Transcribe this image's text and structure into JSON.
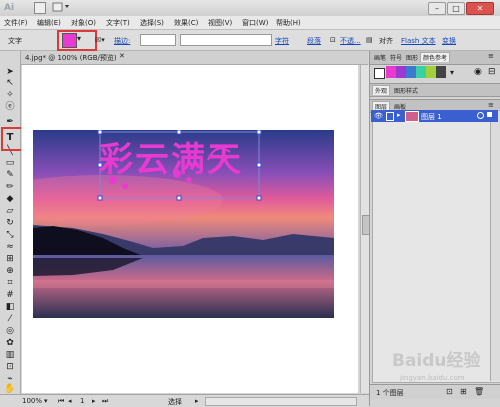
{
  "app": {
    "logo": "Ai"
  },
  "menu": [
    "文件(F)",
    "编辑(E)",
    "对象(O)",
    "文字(T)",
    "选择(S)",
    "效果(C)",
    "视图(V)",
    "窗口(W)",
    "帮助(H)"
  ],
  "control": {
    "tool_label": "文字",
    "fill_color": "#e73ad0",
    "stroke_label": "描边:",
    "char_link": "字符",
    "para_link": "段落",
    "opacity_link": "不透...",
    "align_label": "对齐",
    "flash_link": "Flash 文本",
    "transform_link": "变换"
  },
  "document": {
    "tab_label": "4.jpg* @ 100% (RGB/预览)",
    "text_art": "彩云满天"
  },
  "status": {
    "zoom": "100%",
    "page": "1",
    "tool": "选择"
  },
  "panels": {
    "top_tabs": [
      "画笔",
      "符号",
      "图形",
      "颜色参考"
    ],
    "appearance_tabs": [
      "外观",
      "图形样式"
    ],
    "layers_tabs": [
      "图层",
      "画板"
    ],
    "layer_name": "图层 1",
    "layer_count": "1 个图层"
  },
  "watermark": {
    "text": "Baidu经验",
    "url": "jingyan.baidu.com"
  },
  "colors": {
    "accent": "#e73ad0",
    "highlight": "#d93a3a",
    "selection": "#3a5fcf"
  }
}
